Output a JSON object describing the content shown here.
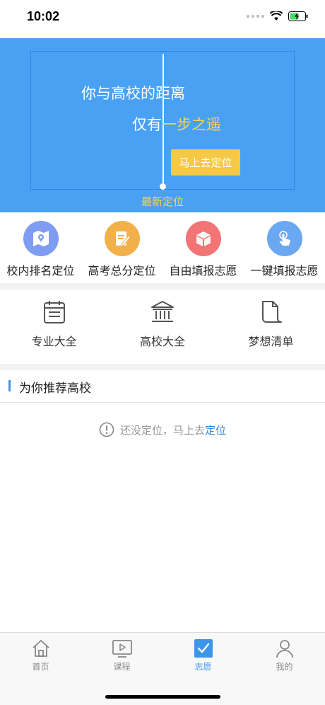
{
  "status": {
    "time": "10:02"
  },
  "banner": {
    "title": "你与高校的距离",
    "sub_prefix": "仅有",
    "sub_highlight": "一步之遥",
    "button": "马上去定位",
    "caption": "最新定位"
  },
  "features": [
    {
      "label": "校内排名定位",
      "icon": "map-icon",
      "color": "#7e9cf2"
    },
    {
      "label": "高考总分定位",
      "icon": "edit-icon",
      "color": "#f2b04a"
    },
    {
      "label": "自由填报志愿",
      "icon": "cube-icon",
      "color": "#f27474"
    },
    {
      "label": "一键填报志愿",
      "icon": "tap-icon",
      "color": "#6aa8f2"
    }
  ],
  "tools": [
    {
      "label": "专业大全",
      "icon": "calendar-list-icon"
    },
    {
      "label": "高校大全",
      "icon": "university-icon"
    },
    {
      "label": "梦想清单",
      "icon": "scroll-icon"
    }
  ],
  "recommend": {
    "title": "为你推荐高校",
    "empty_text": "还没定位，马上去",
    "empty_link": "定位"
  },
  "tabs": [
    {
      "label": "首页",
      "icon": "home-icon"
    },
    {
      "label": "课程",
      "icon": "video-icon"
    },
    {
      "label": "志愿",
      "icon": "checkbox-icon",
      "active": true
    },
    {
      "label": "我的",
      "icon": "person-icon"
    }
  ],
  "colors": {
    "primary": "#49a1f4",
    "accent": "#f5c945",
    "highlight": "#ffd54a",
    "link": "#2f86e6"
  }
}
